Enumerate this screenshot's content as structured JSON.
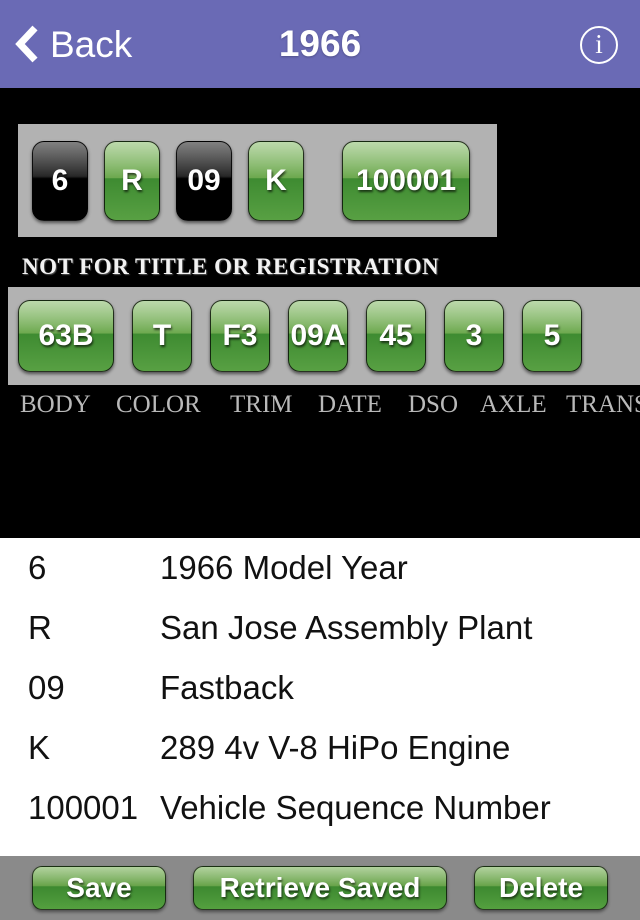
{
  "navbar": {
    "back_label": "Back",
    "title": "1966",
    "info_icon": "info-circle-icon",
    "back_icon": "chevron-left-icon",
    "background_color": "#6a6ab5"
  },
  "vin_strip": {
    "tiles": [
      {
        "value": "6",
        "style": "black"
      },
      {
        "value": "R",
        "style": "green"
      },
      {
        "value": "09",
        "style": "black"
      },
      {
        "value": "K",
        "style": "green"
      },
      {
        "value": "100001",
        "style": "green"
      }
    ]
  },
  "disclaimer": "NOT FOR TITLE OR REGISTRATION",
  "data_plate": {
    "tiles": [
      {
        "value": "63B",
        "label": "BODY"
      },
      {
        "value": "T",
        "label": "COLOR"
      },
      {
        "value": "F3",
        "label": "TRIM"
      },
      {
        "value": "09A",
        "label": "DATE"
      },
      {
        "value": "45",
        "label": "DSO"
      },
      {
        "value": "3",
        "label": "AXLE"
      },
      {
        "value": "5",
        "label": "TRANS"
      }
    ]
  },
  "decoded": [
    {
      "code": "6",
      "description": "1966 Model Year"
    },
    {
      "code": "R",
      "description": "San Jose Assembly Plant"
    },
    {
      "code": "09",
      "description": "Fastback"
    },
    {
      "code": "K",
      "description": "289 4v V-8 HiPo Engine"
    },
    {
      "code": "100001",
      "description": "Vehicle Sequence Number"
    }
  ],
  "toolbar": {
    "save_label": "Save",
    "retrieve_label": "Retrieve Saved",
    "delete_label": "Delete"
  },
  "colors": {
    "accent": "#6a6ab5",
    "tile_green": "#58a043",
    "strip_gray": "#b2b2b2",
    "toolbar_gray": "#8a8a8a"
  }
}
